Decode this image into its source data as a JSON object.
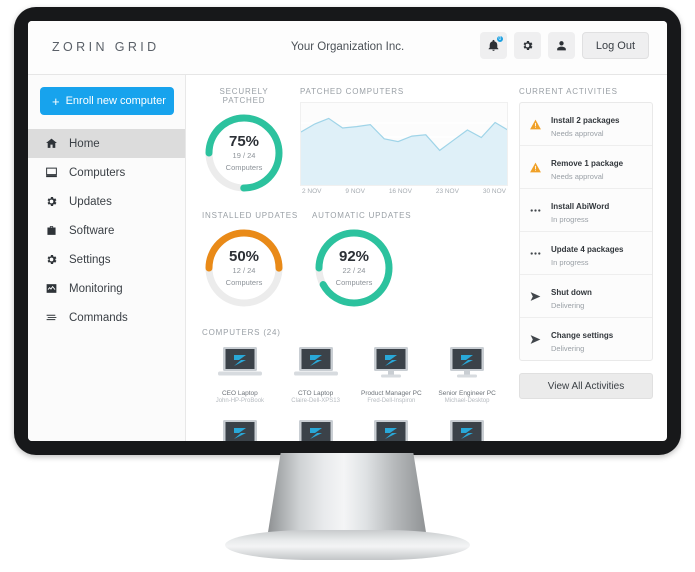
{
  "header": {
    "brand": "ZORIN GRID",
    "org_title": "Your Organization Inc.",
    "logout_label": "Log Out",
    "notification_count": "0",
    "icons": [
      "bell-icon",
      "gear-icon",
      "person-icon"
    ]
  },
  "sidebar": {
    "enroll_label": "Enroll new computer",
    "items": [
      {
        "label": "Home",
        "icon": "home-icon",
        "active": true
      },
      {
        "label": "Computers",
        "icon": "monitor-icon",
        "active": false
      },
      {
        "label": "Updates",
        "icon": "refresh-icon",
        "active": false
      },
      {
        "label": "Software",
        "icon": "briefcase-icon",
        "active": false
      },
      {
        "label": "Settings",
        "icon": "gear-icon",
        "active": false
      },
      {
        "label": "Monitoring",
        "icon": "chart-icon",
        "active": false
      },
      {
        "label": "Commands",
        "icon": "terminal-icon",
        "active": false
      }
    ]
  },
  "widgets": {
    "securely_patched": {
      "label": "Securely Patched",
      "percent": "75%",
      "value": 75,
      "fraction": "19 / 24",
      "unit": "Computers",
      "color": "#2cc29e"
    },
    "installed_updates": {
      "label": "Installed Updates",
      "percent": "50%",
      "value": 50,
      "fraction": "12 / 24",
      "unit": "Computers",
      "color": "#e98a18"
    },
    "automatic_updates": {
      "label": "Automatic Updates",
      "percent": "92%",
      "value": 92,
      "fraction": "22 / 24",
      "unit": "Computers",
      "color": "#2cc29e"
    }
  },
  "chart_data": {
    "type": "area",
    "title": "Patched Computers",
    "xlabel": "",
    "ylabel": "",
    "grid": true,
    "legend_position": "none",
    "line_color": "#9fd4e8",
    "fill_color": "#dff0f8",
    "tick_labels": [
      "2 NOV",
      "9 NOV",
      "16 NOV",
      "23 NOV",
      "30 NOV"
    ],
    "ylim": [
      0,
      100
    ],
    "x": [
      1,
      2,
      3,
      4,
      5,
      6,
      7,
      8,
      9,
      10,
      11,
      12,
      13,
      14,
      15
    ],
    "values": [
      72,
      84,
      92,
      78,
      80,
      83,
      62,
      58,
      66,
      68,
      45,
      60,
      75,
      64,
      86,
      74
    ]
  },
  "computers": {
    "label": "Computers (24)",
    "count": "24",
    "items": [
      {
        "name": "CEO Laptop",
        "host": "John-HP-ProBook",
        "type": "laptop"
      },
      {
        "name": "CTO Laptop",
        "host": "Claire-Dell-XPS13",
        "type": "laptop"
      },
      {
        "name": "Product Manager PC",
        "host": "Fred-Dell-Inspiron",
        "type": "desktop"
      },
      {
        "name": "Senior Engineer PC",
        "host": "Michael-Desktop",
        "type": "desktop"
      },
      {
        "name": "",
        "host": "",
        "type": "desktop"
      },
      {
        "name": "",
        "host": "",
        "type": "laptop"
      },
      {
        "name": "",
        "host": "",
        "type": "desktop"
      },
      {
        "name": "",
        "host": "",
        "type": "desktop"
      }
    ]
  },
  "activities": {
    "label": "Current Activities",
    "view_all_label": "View All Activities",
    "items": [
      {
        "title": "Install 2 packages",
        "status": "Needs approval",
        "icon": "warning-icon"
      },
      {
        "title": "Remove 1 package",
        "status": "Needs approval",
        "icon": "warning-icon"
      },
      {
        "title": "Install AbiWord",
        "status": "In progress",
        "icon": "ellipsis-icon"
      },
      {
        "title": "Update 4 packages",
        "status": "In progress",
        "icon": "ellipsis-icon"
      },
      {
        "title": "Shut down",
        "status": "Delivering",
        "icon": "send-icon"
      },
      {
        "title": "Change settings",
        "status": "Delivering",
        "icon": "send-icon"
      }
    ]
  }
}
